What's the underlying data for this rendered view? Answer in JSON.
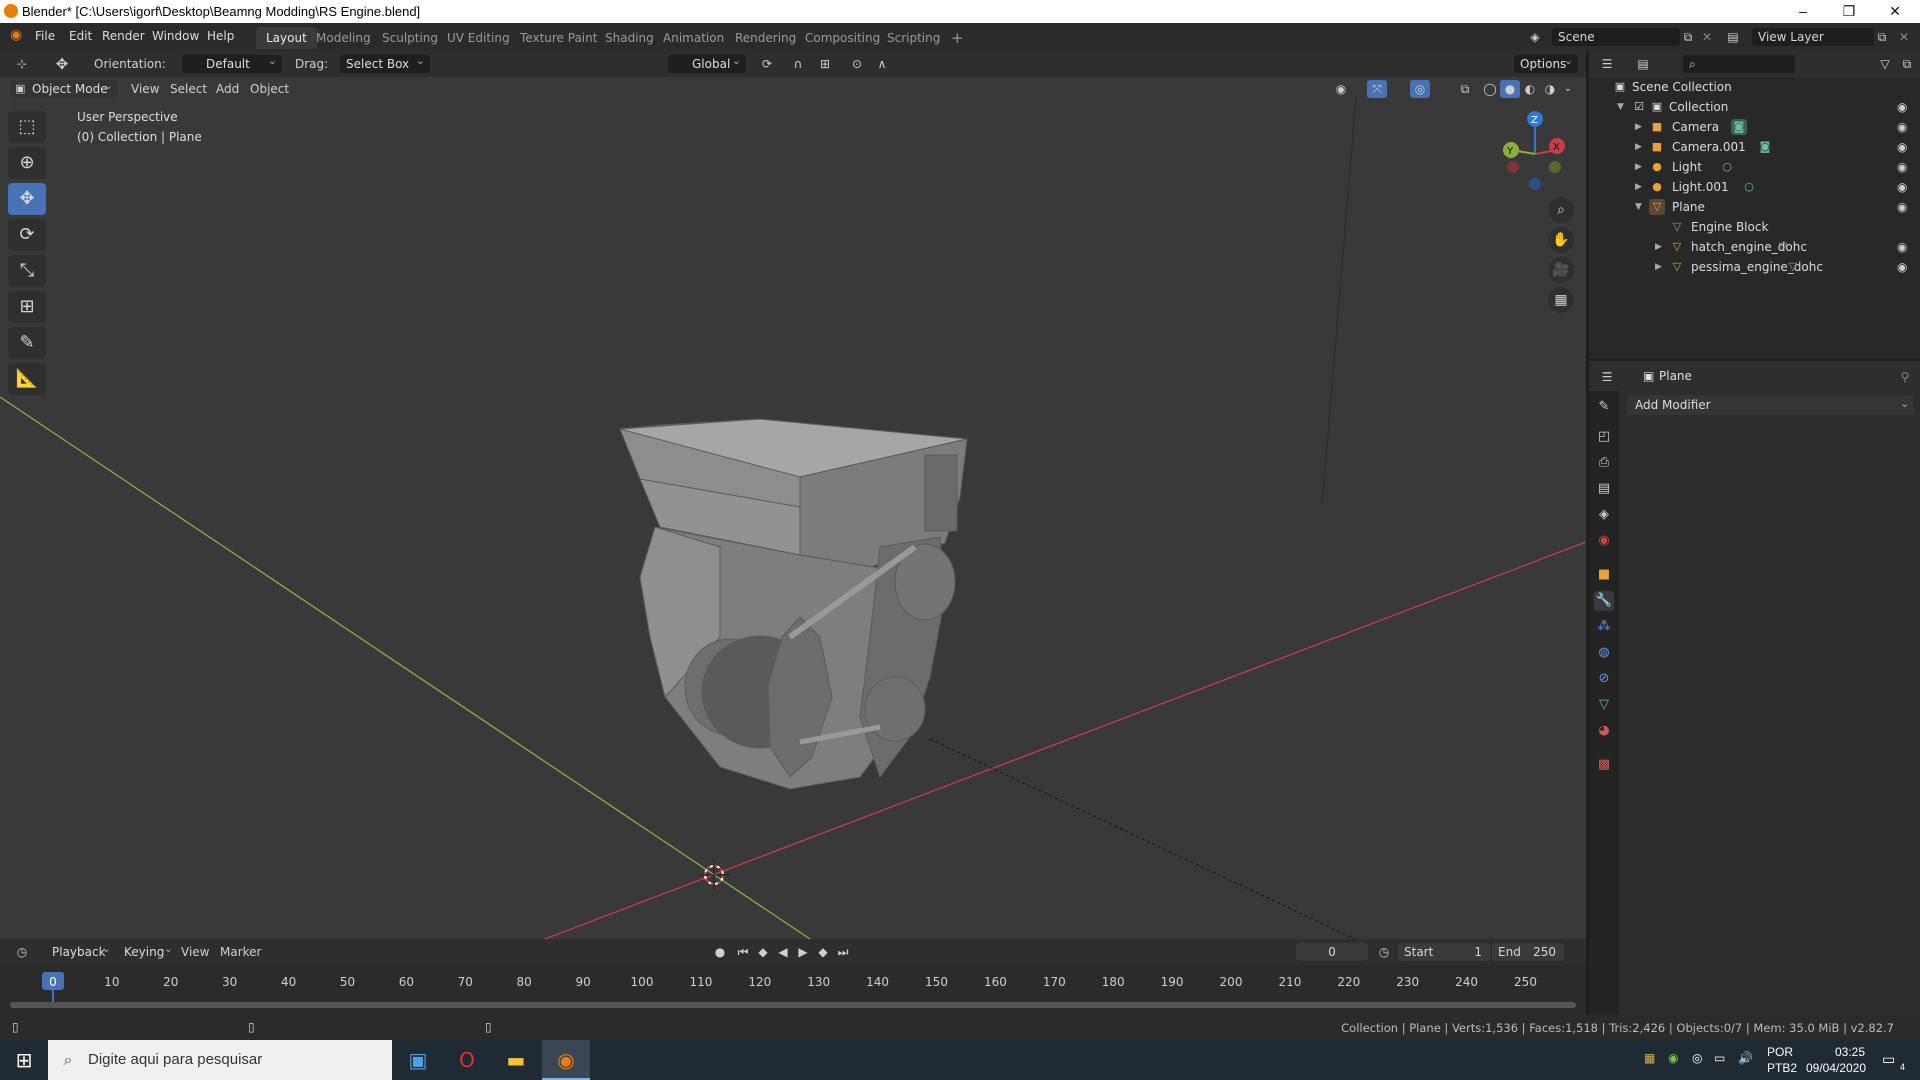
{
  "window": {
    "title": "Blender* [C:\\Users\\igorf\\Desktop\\Beamng Modding\\RS Engine.blend]",
    "minimize": "–",
    "restore": "❐",
    "close": "✕"
  },
  "menu": [
    "File",
    "Edit",
    "Render",
    "Window",
    "Help"
  ],
  "workspaces": [
    {
      "label": "Layout",
      "active": true
    },
    {
      "label": "Modeling"
    },
    {
      "label": "Sculpting"
    },
    {
      "label": "UV Editing"
    },
    {
      "label": "Texture Paint"
    },
    {
      "label": "Shading"
    },
    {
      "label": "Animation"
    },
    {
      "label": "Rendering"
    },
    {
      "label": "Compositing"
    },
    {
      "label": "Scripting"
    }
  ],
  "add_workspace": "+",
  "scene": {
    "name": "Scene",
    "view_layer": "View Layer"
  },
  "tool_header": {
    "orientation_label": "Orientation:",
    "orientation_value": "Default",
    "drag_label": "Drag:",
    "drag_value": "Select Box",
    "transform_space": "Global",
    "options": "Options"
  },
  "viewport_header": {
    "mode": "Object Mode",
    "items": [
      "View",
      "Select",
      "Add",
      "Object"
    ]
  },
  "viewport": {
    "perspective": "User Perspective",
    "collection_info": "(0) Collection | Plane",
    "gizmo": {
      "z": "Z",
      "y": "Y",
      "x": "X"
    }
  },
  "outliner": {
    "root": "Scene Collection",
    "rows": [
      {
        "name": "Collection",
        "icon": "collection-icon"
      },
      {
        "name": "Camera",
        "icon": "camera-icon"
      },
      {
        "name": "Camera.001",
        "icon": "camera-icon"
      },
      {
        "name": "Light",
        "icon": "light-icon"
      },
      {
        "name": "Light.001",
        "icon": "light-icon"
      },
      {
        "name": "Plane",
        "icon": "mesh-icon"
      },
      {
        "name": "Engine Block",
        "icon": "mesh-data-icon"
      },
      {
        "name": "hatch_engine_dohc",
        "icon": "mesh-icon"
      },
      {
        "name": "pessima_engine_dohc",
        "icon": "mesh-icon"
      }
    ]
  },
  "properties": {
    "object_name": "Plane",
    "add_modifier": "Add Modifier"
  },
  "timeline": {
    "menus": [
      "Playback",
      "Keying",
      "View",
      "Marker"
    ],
    "current_frame": "0",
    "start_label": "Start",
    "start": "1",
    "end_label": "End",
    "end": "250",
    "ticks": [
      "0",
      "10",
      "20",
      "30",
      "40",
      "50",
      "60",
      "70",
      "80",
      "90",
      "100",
      "110",
      "120",
      "130",
      "140",
      "150",
      "160",
      "170",
      "180",
      "190",
      "200",
      "210",
      "220",
      "230",
      "240",
      "250"
    ]
  },
  "status": "Collection | Plane | Verts:1,536 | Faces:1,518 | Tris:2,426 | Objects:0/7 | Mem: 35.0 MiB | v2.82.7",
  "taskbar": {
    "search_placeholder": "Digite aqui para pesquisar",
    "lang": "POR",
    "layout": "PTB2",
    "time": "03:25",
    "date": "09/04/2020",
    "notif_count": "4"
  },
  "colors": {
    "accent": "#4772b3",
    "x_axis": "#c43f48",
    "y_axis": "#8aae3f",
    "z_axis": "#2f78d6",
    "blender_orange": "#e87d0d"
  }
}
